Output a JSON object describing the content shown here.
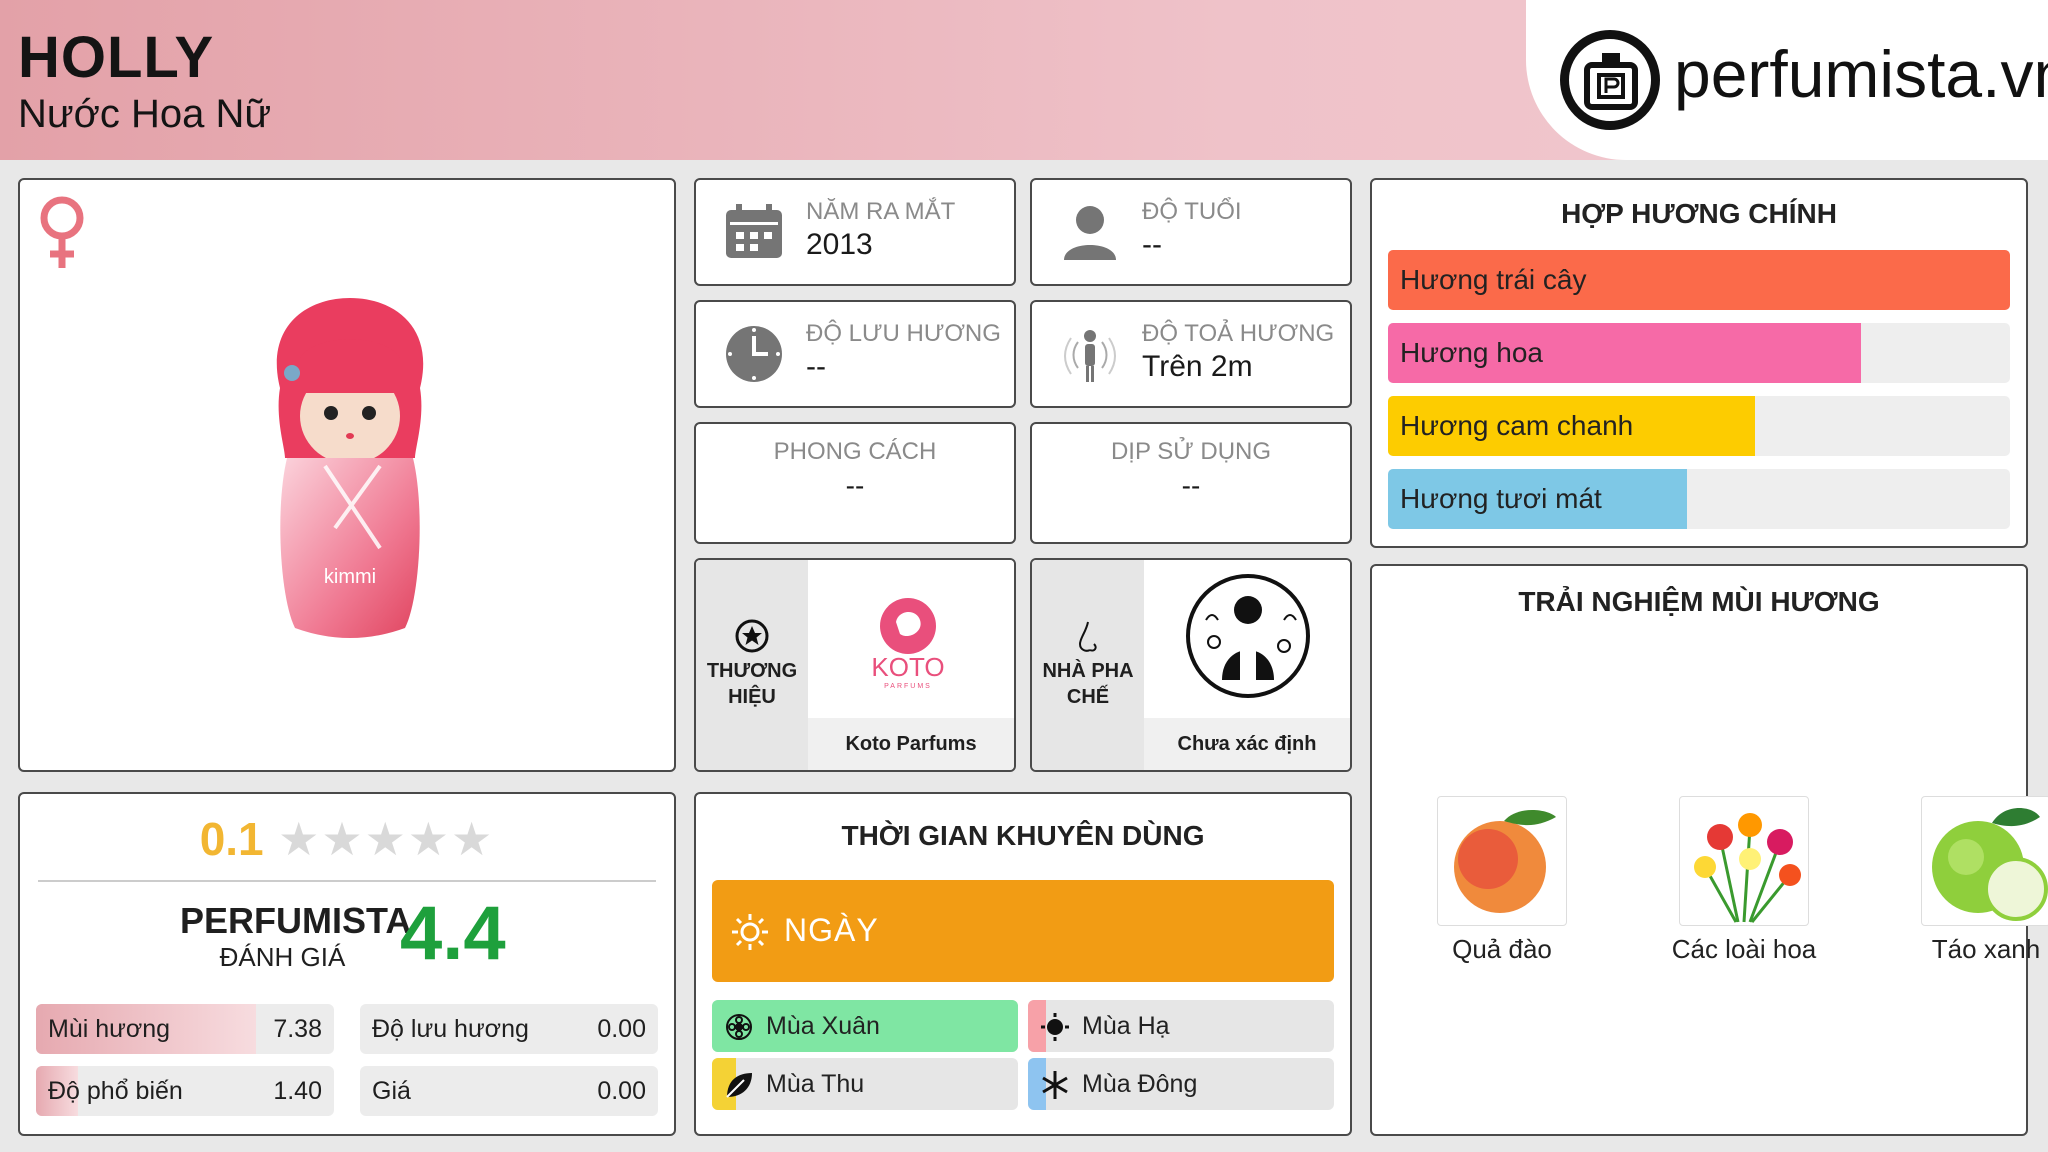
{
  "header": {
    "title": "HOLLY",
    "subtitle": "Nước Hoa Nữ",
    "logo_text": "perfumista.vn"
  },
  "rating": {
    "user_score": "0.1",
    "user_stars_filled": 0,
    "stars_total": 5,
    "perfumista_label": "PERFUMISTA",
    "perfumista_sub": "ĐÁNH GIÁ",
    "perfumista_score": "4.4",
    "metrics": [
      {
        "label": "Mùi hương",
        "value": "7.38",
        "fill": 0.738
      },
      {
        "label": "Độ lưu hương",
        "value": "0.00",
        "fill": 0.0
      },
      {
        "label": "Độ phổ biến",
        "value": "1.40",
        "fill": 0.14
      },
      {
        "label": "Giá",
        "value": "0.00",
        "fill": 0.0
      }
    ]
  },
  "info": {
    "launch_year": {
      "label": "NĂM RA MẮT",
      "value": "2013"
    },
    "age": {
      "label": "ĐỘ TUỔI",
      "value": "--"
    },
    "longevity": {
      "label": "ĐỘ LƯU HƯƠNG",
      "value": "--"
    },
    "sillage": {
      "label": "ĐỘ TOẢ HƯƠNG",
      "value": "Trên 2m"
    },
    "style": {
      "label": "PHONG CÁCH",
      "value": "--"
    },
    "occasion": {
      "label": "DỊP SỬ DỤNG",
      "value": "--"
    }
  },
  "brand": {
    "label": "THƯƠNG HIỆU",
    "name": "Koto Parfums",
    "logo_text": "KOTO",
    "logo_sub": "PARFUMS"
  },
  "perfumer": {
    "label": "NHÀ PHA CHẾ",
    "name": "Chưa xác định"
  },
  "bottle_label": "kimmi",
  "accords": {
    "title": "HỢP HƯƠNG CHÍNH",
    "items": [
      {
        "label": "Hương trái cây",
        "fill": 1.0,
        "color": "#fb6a4a"
      },
      {
        "label": "Hương hoa",
        "fill": 0.76,
        "color": "#f66aa7"
      },
      {
        "label": "Hương cam chanh",
        "fill": 0.59,
        "color": "#fdcc00"
      },
      {
        "label": "Hương tươi mát",
        "fill": 0.48,
        "color": "#7ec8e6"
      }
    ]
  },
  "time": {
    "title": "THỜI GIAN KHUYÊN DÙNG",
    "day": {
      "label": "NGÀY",
      "color": "#f29c14"
    },
    "seasons": [
      {
        "label": "Mùa Xuân",
        "fill": 1.0,
        "color": "#7fe6a3"
      },
      {
        "label": "Mùa Hạ",
        "fill": 0.06,
        "color": "#f7a1a8"
      },
      {
        "label": "Mùa Thu",
        "fill": 0.08,
        "color": "#f4d235"
      },
      {
        "label": "Mùa Đông",
        "fill": 0.06,
        "color": "#8ec4f0"
      }
    ]
  },
  "notes": {
    "title": "TRẢI NGHIỆM MÙI HƯƠNG",
    "items": [
      {
        "label": "Quả đào",
        "icon": "peach-icon"
      },
      {
        "label": "Các loài hoa",
        "icon": "flowers-icon"
      },
      {
        "label": "Táo xanh",
        "icon": "green-apple-icon"
      }
    ]
  }
}
